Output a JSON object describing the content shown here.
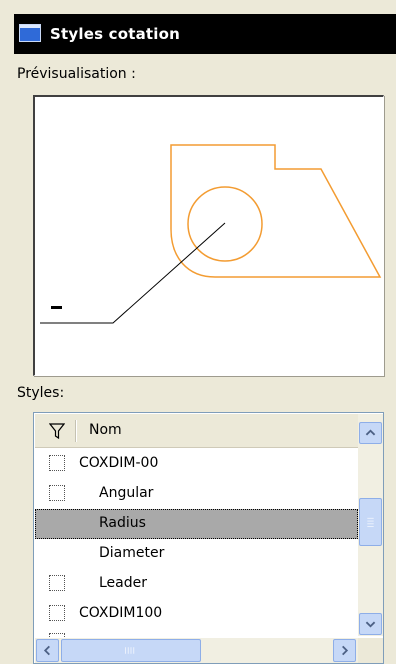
{
  "window": {
    "title": "Styles cotation"
  },
  "preview": {
    "label": "Prévisualisation :"
  },
  "styles": {
    "label": "Styles:",
    "column_header": "Nom",
    "rows": [
      {
        "label": "COXDIM-00",
        "checkbox": true,
        "indent": false,
        "selected": false
      },
      {
        "label": "Angular",
        "checkbox": true,
        "indent": true,
        "selected": false
      },
      {
        "label": "Radius",
        "checkbox": false,
        "indent": true,
        "selected": true
      },
      {
        "label": "Diameter",
        "checkbox": false,
        "indent": true,
        "selected": false
      },
      {
        "label": "Leader",
        "checkbox": true,
        "indent": true,
        "selected": false
      },
      {
        "label": "COXDIM100",
        "checkbox": true,
        "indent": false,
        "selected": false
      }
    ]
  },
  "colors": {
    "shape_stroke": "#f39c32",
    "selection": "#a9a9a9"
  },
  "icons": [
    "window-icon",
    "filter-icon",
    "scroll-up-icon",
    "scroll-down-icon",
    "scroll-left-icon",
    "scroll-right-icon",
    "grip-icon"
  ]
}
